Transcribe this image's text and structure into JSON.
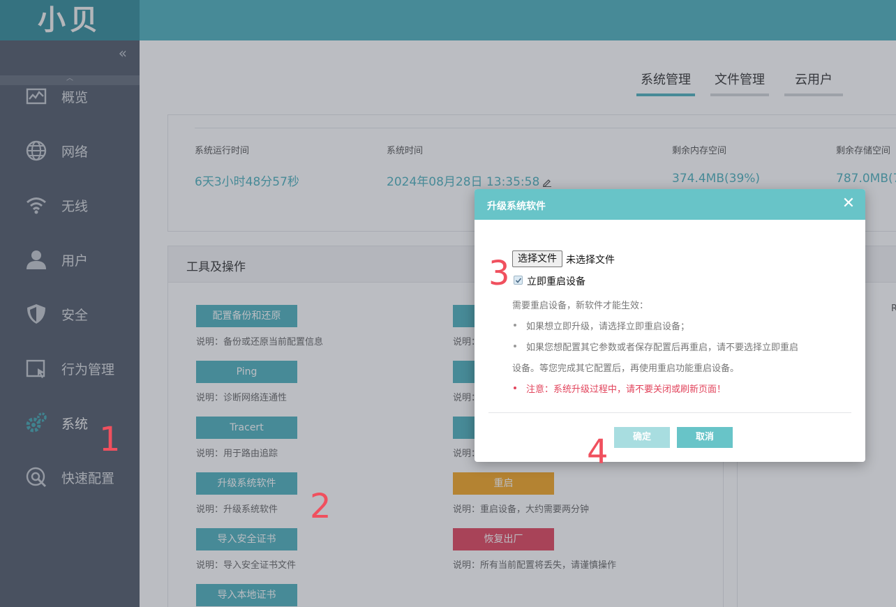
{
  "logo": "小贝",
  "sidebar": {
    "collapse": "«",
    "scroll_up": "︿",
    "items": [
      {
        "label": "概览",
        "icon": "chart-icon"
      },
      {
        "label": "网络",
        "icon": "globe-icon"
      },
      {
        "label": "无线",
        "icon": "wifi-icon"
      },
      {
        "label": "用户",
        "icon": "user-icon"
      },
      {
        "label": "安全",
        "icon": "shield-icon"
      },
      {
        "label": "行为管理",
        "icon": "behavior-icon"
      },
      {
        "label": "系统",
        "icon": "gear-icon"
      },
      {
        "label": "快速配置",
        "icon": "quick-config-icon"
      }
    ],
    "active_index": 6
  },
  "tabs": [
    {
      "label": "系统管理",
      "active": true
    },
    {
      "label": "文件管理",
      "active": false
    },
    {
      "label": "云用户",
      "active": false
    }
  ],
  "status": {
    "uptime_label": "系统运行时间",
    "uptime_value": "6天3小时48分57秒",
    "time_label": "系统时间",
    "time_value": "2024年08月28日 13:35:58",
    "memory_label": "剩余内存空间",
    "memory_value": "374.4MB(39%)",
    "storage_label": "剩余存储空间",
    "storage_value": "787.0MB(7"
  },
  "tools": {
    "title": "工具及操作",
    "left": [
      {
        "button": "配置备份和还原",
        "desc": "说明：备份或还原当前配置信息"
      },
      {
        "button": "Ping",
        "desc": "说明：诊断网络连通性"
      },
      {
        "button": "Tracert",
        "desc": "说明：用于路由追踪"
      },
      {
        "button": "升级系统软件",
        "desc": "说明：升级系统软件"
      },
      {
        "button": "导入安全证书",
        "desc": "说明：导入安全证书文件"
      },
      {
        "button": "导入本地证书",
        "desc": ""
      }
    ],
    "right_partial_desc": [
      "说明：",
      "说明：",
      "说明："
    ],
    "reboot": {
      "button": "重启",
      "desc": "说明：重启设备，大约需要两分钟"
    },
    "factory": {
      "button": "恢复出厂",
      "desc": "说明：所有当前配置将丢失，请谨慎操作"
    },
    "right_panel_letter": "R"
  },
  "dialog": {
    "title": "升级系统软件",
    "close": "✕",
    "file_button": "选择文件",
    "file_status": "未选择文件",
    "reboot_checkbox": "立即重启设备",
    "reboot_checked": true,
    "tip_title": "需要重启设备，新软件才能生效：",
    "tip1": "如果想立即升级，请选择立即重启设备；",
    "tip2_line1": "如果您想配置其它参数或者保存配置后再重启，请不要选择立即重启",
    "tip2_line2": "设备。等您完成其它配置后，再使用重启功能重启设备。",
    "warning": "注意：系统升级过程中，请不要关闭或刷新页面！",
    "ok": "确定",
    "cancel": "取消"
  },
  "steps": [
    "1",
    "2",
    "3",
    "4"
  ],
  "colors": {
    "accent": "#4db1bd",
    "warn": "#f5a623",
    "danger": "#e2445c",
    "sidebar": "#5b6475",
    "step": "#f0505e"
  }
}
